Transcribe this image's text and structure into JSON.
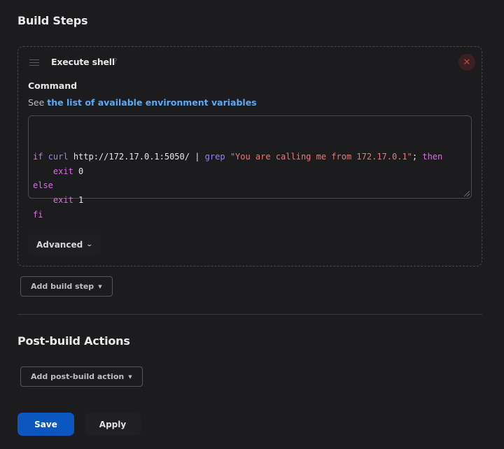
{
  "build_steps": {
    "title": "Build Steps",
    "step": {
      "title": "Execute shell",
      "help_icon": "?",
      "close_icon": "✕",
      "command_label": "Command",
      "see_prefix": "See ",
      "env_link": "the list of available environment variables",
      "code_lines": [
        [
          {
            "t": "if",
            "c": "kw"
          },
          {
            "t": " "
          },
          {
            "t": "curl",
            "c": "cmd"
          },
          {
            "t": " http://172.17.0.1:5050/ | "
          },
          {
            "t": "grep",
            "c": "cmd"
          },
          {
            "t": " "
          },
          {
            "t": "\"You are calling me from 172.17.0.1\"",
            "c": "str"
          },
          {
            "t": "; "
          },
          {
            "t": "then",
            "c": "kw"
          }
        ],
        [
          {
            "t": "    "
          },
          {
            "t": "exit",
            "c": "kw"
          },
          {
            "t": " 0"
          }
        ],
        [
          {
            "t": "else",
            "c": "kw"
          }
        ],
        [
          {
            "t": "    "
          },
          {
            "t": "exit",
            "c": "kw"
          },
          {
            "t": " 1"
          }
        ],
        [
          {
            "t": "fi",
            "c": "kw"
          }
        ]
      ],
      "advanced_label": "Advanced"
    },
    "add_step_label": "Add build step"
  },
  "post_build": {
    "title": "Post-build Actions",
    "add_action_label": "Add post-build action"
  },
  "footer": {
    "save_label": "Save",
    "apply_label": "Apply"
  },
  "colors": {
    "background": "#1c1c1f",
    "accent": "#0c56c0",
    "link": "#5aaaf5",
    "keyword": "#d86fe0",
    "command": "#9b7bf5",
    "string": "#f07474",
    "danger": "#c8423f"
  },
  "icons": {
    "drag": "drag-handle-icon",
    "help": "help-icon",
    "close": "close-icon",
    "chevron": "chevron-down-icon",
    "caret": "caret-down-icon"
  }
}
